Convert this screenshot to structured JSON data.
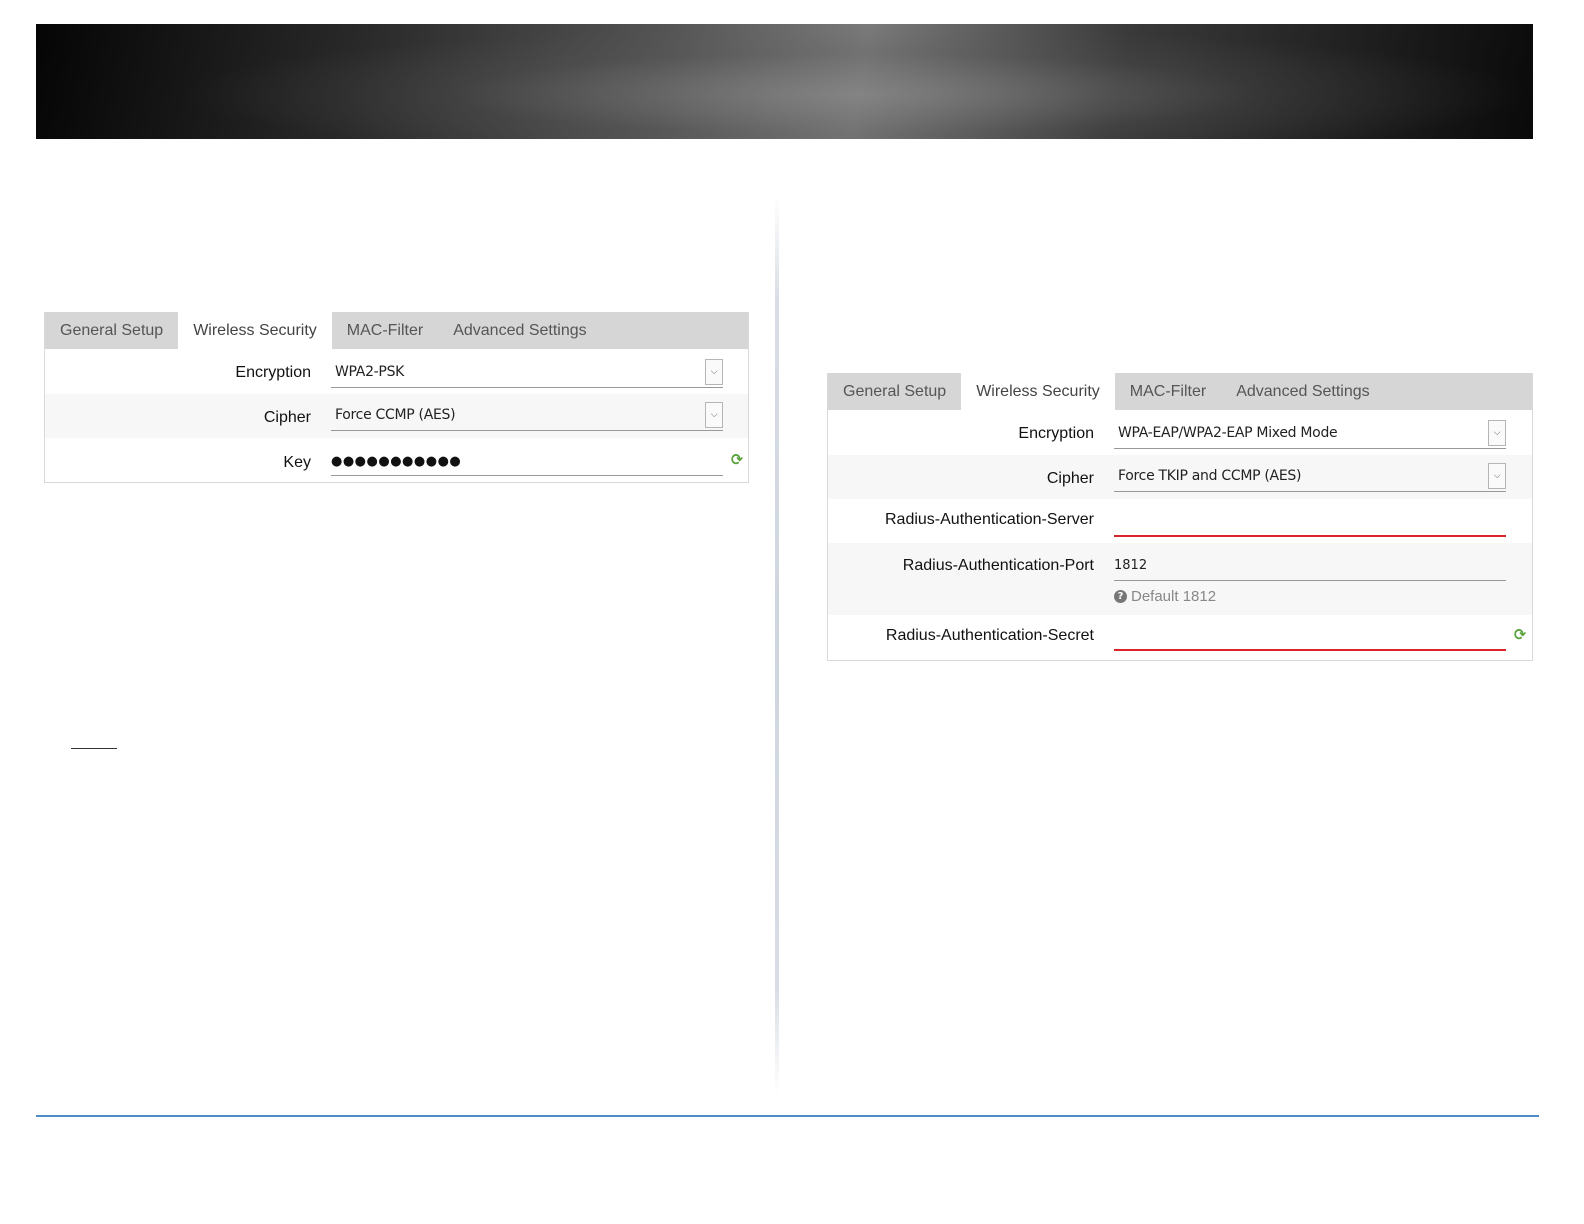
{
  "left_panel": {
    "tabs": [
      "General Setup",
      "Wireless Security",
      "MAC-Filter",
      "Advanced Settings"
    ],
    "active_tab": "Wireless Security",
    "encryption": {
      "label": "Encryption",
      "value": "WPA2-PSK"
    },
    "cipher": {
      "label": "Cipher",
      "value": "Force CCMP (AES)"
    },
    "key": {
      "label": "Key",
      "value": "●●●●●●●●●●●"
    }
  },
  "right_panel": {
    "tabs": [
      "General Setup",
      "Wireless Security",
      "MAC-Filter",
      "Advanced Settings"
    ],
    "active_tab": "Wireless Security",
    "encryption": {
      "label": "Encryption",
      "value": "WPA-EAP/WPA2-EAP Mixed Mode"
    },
    "cipher": {
      "label": "Cipher",
      "value": "Force TKIP and CCMP (AES)"
    },
    "radius_server": {
      "label": "Radius-Authentication-Server",
      "value": ""
    },
    "radius_port": {
      "label": "Radius-Authentication-Port",
      "value": "1812",
      "hint": "Default 1812"
    },
    "radius_secret": {
      "label": "Radius-Authentication-Secret",
      "value": ""
    }
  },
  "icons": {
    "dropdown": "chevron-down-icon",
    "refresh": "refresh-icon",
    "help": "question-circle-icon"
  },
  "colors": {
    "invalid_underline": "#d9252a",
    "footer_rule": "#4f8bc4",
    "refresh_icon": "#58a13b",
    "tabbar_bg": "#d6d6d6"
  }
}
